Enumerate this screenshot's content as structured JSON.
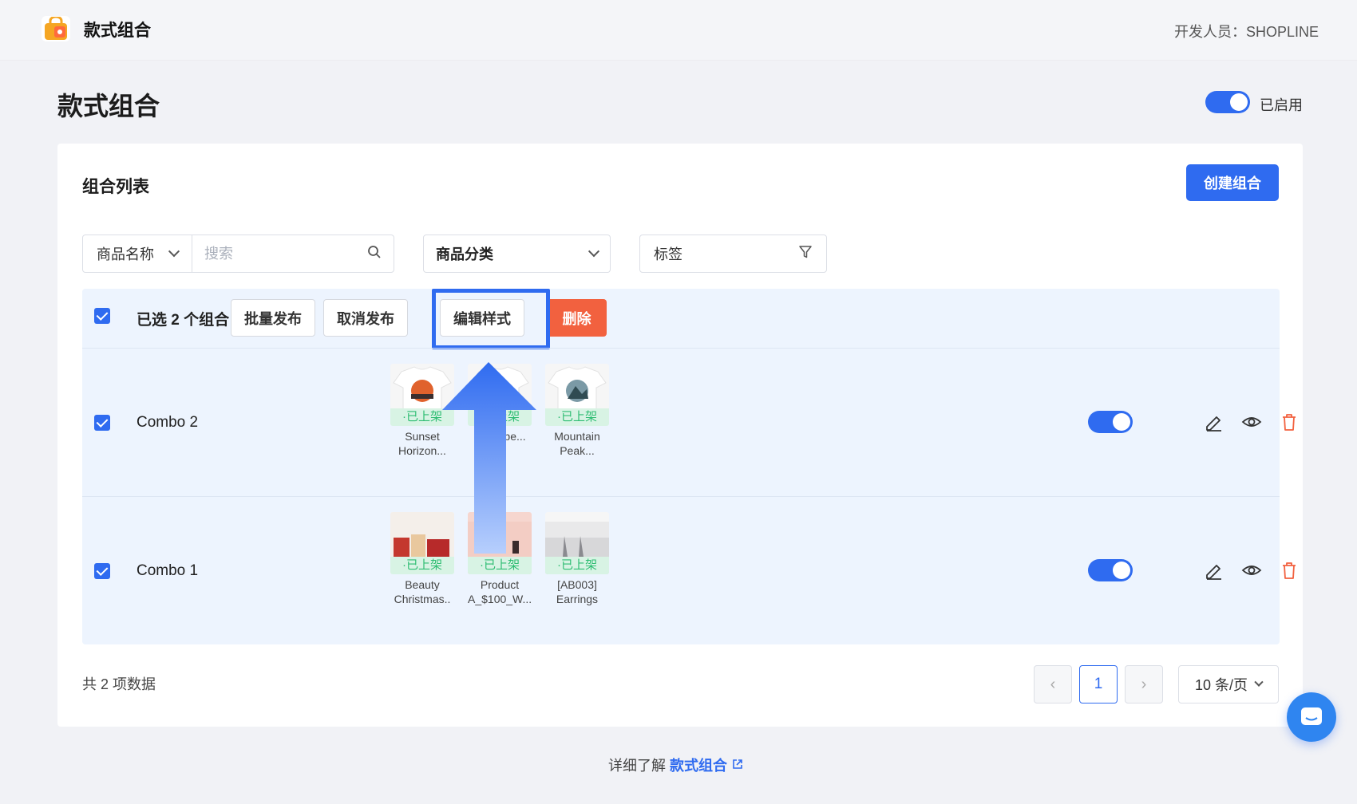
{
  "topbar": {
    "app_name": "款式组合",
    "developer": "开发人员：SHOPLINE"
  },
  "page": {
    "title": "款式组合",
    "status_label": "已启用",
    "status_enabled": true
  },
  "card": {
    "title": "组合列表",
    "create_button": "创建组合"
  },
  "filters": {
    "field_select": "商品名称",
    "search_placeholder": "搜索",
    "category": "商品分类",
    "tag": "标签"
  },
  "bulk": {
    "selected_text": "已选 2 个组合",
    "batch_publish": "批量发布",
    "unpublish": "取消发布",
    "edit_style": "编辑样式",
    "delete": "删除"
  },
  "rows": [
    {
      "name": "Combo 2",
      "checked": true,
      "enabled": true,
      "products": [
        {
          "name": "Sunset Horizon...",
          "status": "·已上架",
          "icon": "tshirt-sunset-thumbnail"
        },
        {
          "name": "...st ...pe...",
          "status": "·已上架",
          "icon": "tshirt-thumbnail"
        },
        {
          "name": "Mountain Peak...",
          "status": "·已上架",
          "icon": "tshirt-mountain-thumbnail"
        }
      ]
    },
    {
      "name": "Combo 1",
      "checked": true,
      "enabled": true,
      "products": [
        {
          "name": "Beauty Christmas..",
          "status": "·已上架",
          "icon": "gift-thumbnail"
        },
        {
          "name": "Product A_$100_W...",
          "status": "·已上架",
          "icon": "cosmetics-thumbnail"
        },
        {
          "name": "[AB003] Earrings",
          "status": "·已上架",
          "icon": "earrings-thumbnail"
        }
      ]
    }
  ],
  "footer": {
    "total": "共 2 项数据",
    "current_page": "1",
    "page_size": "10 条/页",
    "learn_more_prefix": "详细了解",
    "learn_more_link": "款式组合"
  },
  "colors": {
    "accent": "#2f6bf0",
    "danger": "#f2613f",
    "success": "#2ebd72"
  }
}
